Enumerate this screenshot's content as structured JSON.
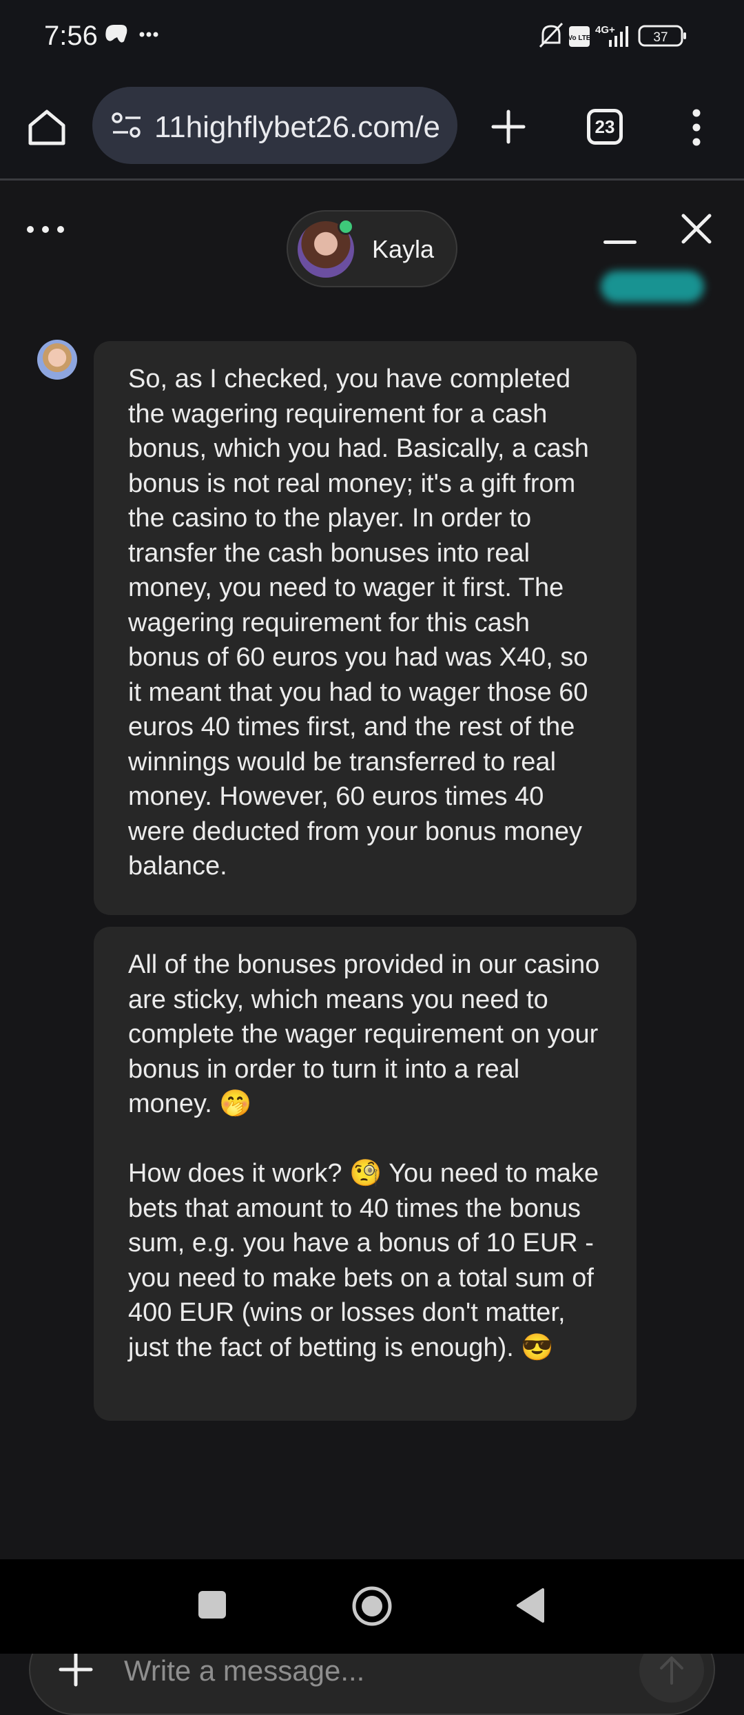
{
  "status_bar": {
    "time": "7:56",
    "network": "4G+",
    "volte": "Vo LTE",
    "battery": "37"
  },
  "browser": {
    "url": "11highflybet26.com/e",
    "tab_count": "23"
  },
  "chat": {
    "agent_name": "Kayla",
    "agent_status": "online",
    "messages": [
      {
        "text": "So, as I checked, you have completed the wagering requirement for a cash bonus, which you had. Basically, a cash bonus is not real money; it's a gift from the casino to the player. In order to transfer the cash bonuses into real money, you need to wager it first. The wagering requirement for this cash bonus of 60 euros you had was X40, so it meant that you had to wager those 60 euros 40 times first, and the rest of the winnings would be transferred to real money. However, 60 euros times 40 were deducted from your bonus money balance."
      },
      {
        "text": "All of the bonuses provided in our casino are sticky, which means you need to complete the wager requirement on your bonus in order to turn it into a real money. 🤭\n\nHow does it work? 🧐 You need to make bets that amount to 40 times the bonus sum, e.g. you have a bonus of 10 EUR - you need to make bets on a total sum of 400 EUR (wins or losses don't matter, just the fact of betting is enough). 😎"
      }
    ]
  },
  "composer": {
    "placeholder": "Write a message..."
  },
  "colors": {
    "background": "#161618",
    "bubble": "#272727",
    "accent_teal": "#19a9a8",
    "online": "#3ec97a"
  }
}
